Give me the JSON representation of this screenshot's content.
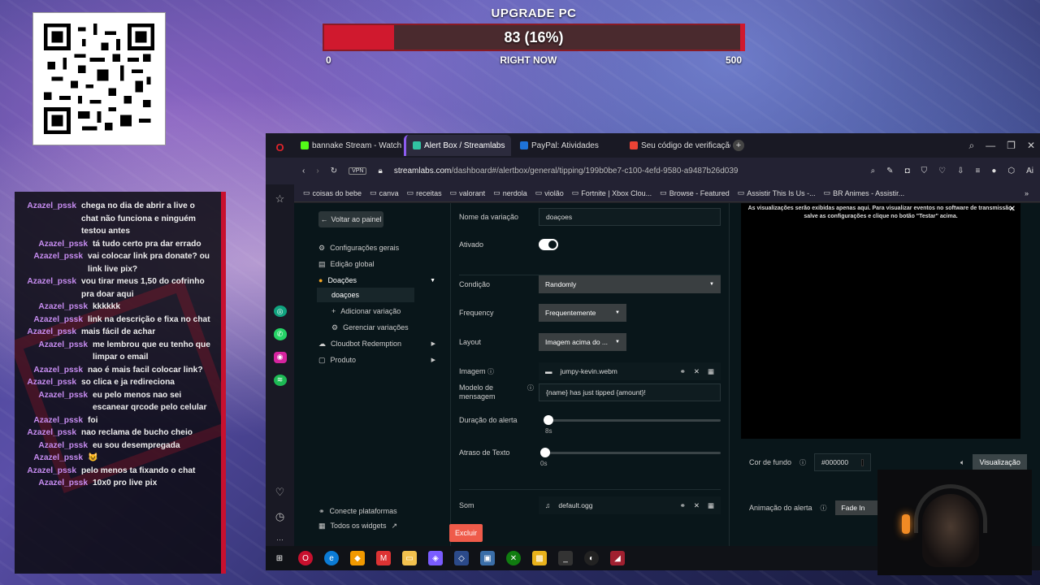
{
  "goal": {
    "title": "UPGRADE PC",
    "value_text": "83 (16%)",
    "progress": 0.166,
    "min": "0",
    "label": "RIGHT NOW",
    "max": "500"
  },
  "chat": [
    {
      "user": "Azazel_pssk",
      "text": "chega no dia de abrir a live o chat não funciona e ninguém testou antes"
    },
    {
      "user": "Azazel_pssk",
      "text": "tá tudo certo pra dar errado"
    },
    {
      "user": "Azazel_pssk",
      "text": "vai colocar link pra donate? ou link live pix?"
    },
    {
      "user": "Azazel_pssk",
      "text": "vou tirar meus 1,50 do cofrinho pra doar aqui"
    },
    {
      "user": "Azazel_pssk",
      "text": "kkkkkk"
    },
    {
      "user": "Azazel_pssk",
      "text": "link na descrição e fixa no chat"
    },
    {
      "user": "Azazel_pssk",
      "text": "mais fácil de achar"
    },
    {
      "user": "Azazel_pssk",
      "text": "me lembrou que eu tenho que limpar o email"
    },
    {
      "user": "Azazel_pssk",
      "text": "nao é mais facil colocar link?"
    },
    {
      "user": "Azazel_pssk",
      "text": "so clica e ja redireciona"
    },
    {
      "user": "Azazel_pssk",
      "text": "eu pelo menos nao sei escanear qrcode pelo celular"
    },
    {
      "user": "Azazel_pssk",
      "text": "foi"
    },
    {
      "user": "Azazel_pssk",
      "text": "nao reclama de bucho cheio"
    },
    {
      "user": "Azazel_pssk",
      "text": "eu sou desempregada"
    },
    {
      "user": "Azazel_pssk",
      "text": "😺"
    },
    {
      "user": "Azazel_pssk",
      "text": "pelo menos ta fixando o chat"
    },
    {
      "user": "Azazel_pssk",
      "text": "10x0 pro live pix"
    }
  ],
  "tabs": [
    {
      "label": "bannake Stream - Watch Li",
      "color": "#53fc18"
    },
    {
      "label": "Alert Box / Streamlabs",
      "color": "#31c3a2"
    },
    {
      "label": "PayPal: Atividades",
      "color": "#1e73d9"
    },
    {
      "label": "Seu código de verificação",
      "color": "#ea4335"
    }
  ],
  "address": {
    "host": "streamlabs.com",
    "path": "/dashboard#/alertbox/general/tipping/199b0be7-c100-4efd-9580-a9487b26d039",
    "vpn": "VPN"
  },
  "bookmarks": [
    "coisas do bebe",
    "canva",
    "receitas",
    "valorant",
    "nerdola",
    "violão",
    "Fortnite | Xbox Clou...",
    "Browse - Featured",
    "Assistir This Is Us -...",
    "BR Animes - Assistir..."
  ],
  "nav": {
    "back": "Voltar ao painel",
    "general": "Configurações gerais",
    "global": "Edição global",
    "donations": "Doações",
    "donations_sub": "doaçoes",
    "add_variation": "Adicionar variação",
    "manage_variations": "Gerenciar variações",
    "cloudbot": "Cloudbot Redemption",
    "product": "Produto",
    "connect": "Conecte plataformas",
    "all_widgets": "Todos os widgets"
  },
  "form": {
    "name_label": "Nome da variação",
    "name_value": "doaçoes",
    "active_label": "Ativado",
    "condition_label": "Condição",
    "condition_value": "Randomly",
    "frequency_label": "Frequency",
    "frequency_value": "Frequentemente",
    "layout_label": "Layout",
    "layout_value": "Imagem acima do ...",
    "image_label": "Imagem",
    "image_value": "jumpy-kevin.webm",
    "message_label": "Modelo de mensagem",
    "message_value": "{name} has just tipped {amount}!",
    "duration_label": "Duração do alerta",
    "duration_value": "8s",
    "text_delay_label": "Atraso de Texto",
    "text_delay_value": "0s",
    "sound_label": "Som",
    "sound_value": "default.ogg",
    "delete": "Excluir"
  },
  "preview": {
    "note_line1": "As visualizações serão exibidas apenas aqui. Para visualizar eventos no software de transmissão,",
    "note_line2": "salve as configurações e clique no botão \"Testar\" acima.",
    "bg_label": "Cor de fundo",
    "bg_value": "#000000",
    "preview_button": "Visualização",
    "anim_label": "Animação do alerta",
    "anim_value": "Fade In"
  }
}
